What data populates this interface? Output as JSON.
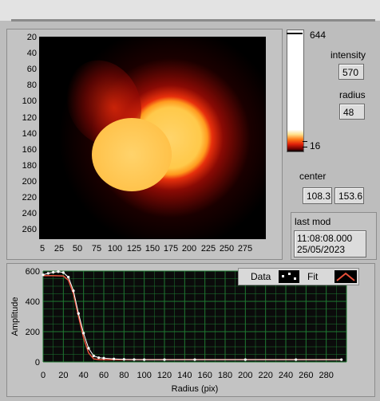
{
  "image_panel": {
    "y_ticks": [
      "20",
      "40",
      "60",
      "80",
      "100",
      "120",
      "140",
      "160",
      "180",
      "200",
      "220",
      "240",
      "260"
    ],
    "x_ticks": [
      "5",
      "25",
      "50",
      "75",
      "100",
      "125",
      "150",
      "175",
      "200",
      "225",
      "250",
      "275"
    ]
  },
  "colorbar": {
    "max_label": "644",
    "min_label": "16"
  },
  "intensity": {
    "label": "intensity",
    "value": "570"
  },
  "radius": {
    "label": "radius",
    "value": "48"
  },
  "center": {
    "label": "center",
    "x": "108.3",
    "y": "153.6"
  },
  "last_mod": {
    "label": "last mod",
    "time": "11:08:08.000",
    "date": "25/05/2023"
  },
  "plot": {
    "legend": {
      "data_label": "Data",
      "fit_label": "Fit",
      "fit_color": "#e8503a"
    },
    "plot_bg": "#0b0b0b",
    "grid_color": "#1f7a32",
    "data_color": "#ffffff"
  },
  "chart_data": {
    "type": "line",
    "xlabel": "Radius (pix)",
    "ylabel": "Amplitude",
    "xlim": [
      0,
      300
    ],
    "ylim": [
      0,
      600
    ],
    "x_ticks": [
      0,
      20,
      40,
      60,
      80,
      100,
      120,
      140,
      160,
      180,
      200,
      220,
      240,
      260,
      280
    ],
    "y_ticks": [
      0,
      200,
      400,
      600
    ],
    "grid": true,
    "legend_position": "top-right",
    "series": [
      {
        "name": "Data",
        "x": [
          0,
          5,
          10,
          15,
          20,
          25,
          30,
          35,
          40,
          45,
          50,
          55,
          60,
          70,
          80,
          90,
          100,
          120,
          150,
          200,
          250,
          295
        ],
        "y": [
          575,
          585,
          592,
          596,
          590,
          560,
          470,
          320,
          190,
          90,
          40,
          28,
          25,
          20,
          17,
          16,
          15,
          15,
          15,
          15,
          15,
          15
        ]
      },
      {
        "name": "Fit",
        "x": [
          0,
          10,
          20,
          25,
          30,
          35,
          40,
          45,
          50,
          55,
          60,
          70,
          100,
          200,
          295
        ],
        "y": [
          570,
          570,
          568,
          540,
          450,
          300,
          160,
          60,
          20,
          16,
          15,
          15,
          15,
          15,
          15
        ]
      }
    ]
  }
}
